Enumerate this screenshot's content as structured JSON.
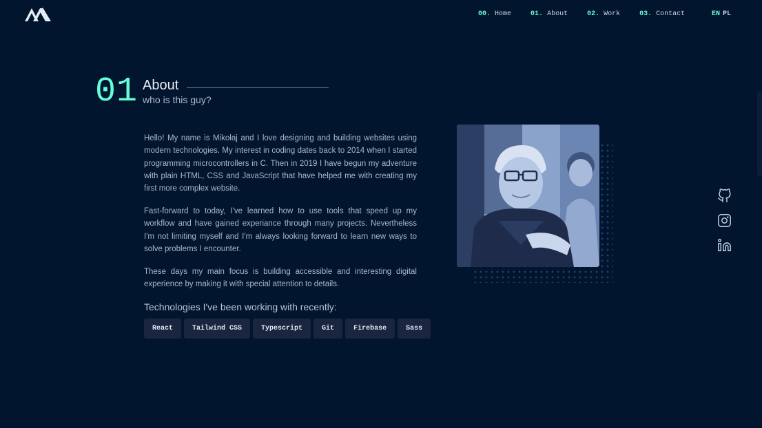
{
  "header": {
    "nav": [
      {
        "num": "00.",
        "label": "Home"
      },
      {
        "num": "01.",
        "label": "About"
      },
      {
        "num": "02.",
        "label": "Work"
      },
      {
        "num": "03.",
        "label": "Contact"
      }
    ],
    "lang_active": "EN",
    "lang_inactive": "PL"
  },
  "section": {
    "number": "01",
    "title": "About",
    "subtitle": "who is this guy?"
  },
  "about": {
    "paragraphs": [
      "Hello! My name is Mikołaj and I love designing and building websites using modern technologies. My interest in coding dates back to 2014 when I started programming microcontrollers in C. Then in 2019 I have begun my adventure with plain HTML, CSS and JavaScript that have helped me with creating my first more complex website.",
      "Fast-forward to today, I've learned how to use tools that speed up my workflow and have gained experiance through many projects. Nevertheless I'm not limiting myself and I'm always looking forward to learn new ways to solve problems I encounter.",
      "These days my main focus is building accessible and interesting digital experience by making it with special attention to details."
    ],
    "tech_title": "Technologies I've been working with recently:",
    "technologies": [
      "React",
      "Tailwind CSS",
      "Typescript",
      "Git",
      "Firebase",
      "Sass"
    ]
  },
  "socials": [
    "github-icon",
    "instagram-icon",
    "linkedin-icon"
  ],
  "colors": {
    "background": "#02152e",
    "accent": "#64ffda",
    "tag_bg": "#1a2540"
  }
}
